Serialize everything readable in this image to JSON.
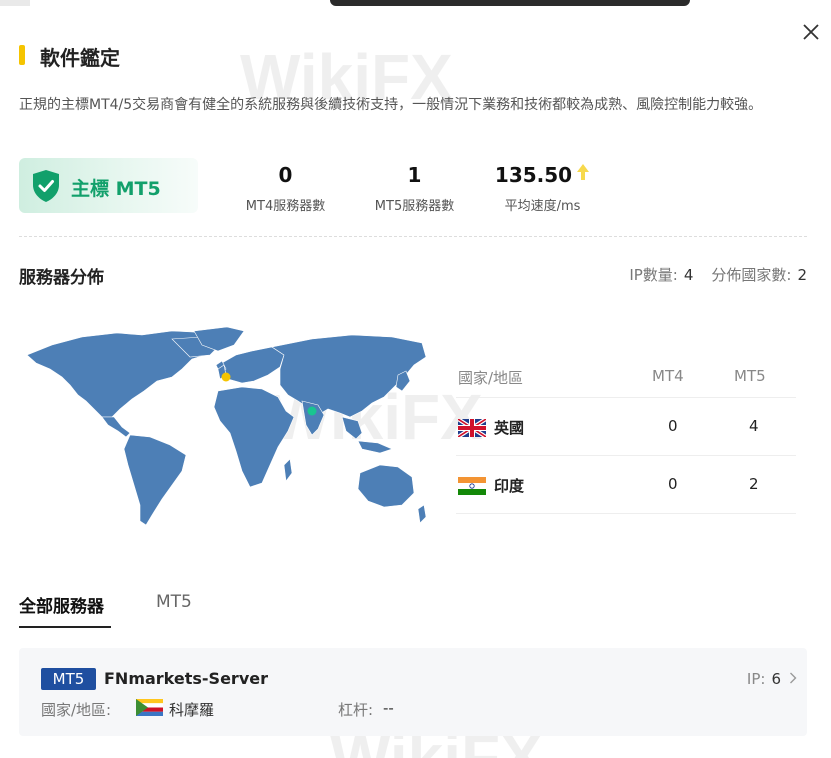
{
  "dialog": {
    "title": "軟件鑑定",
    "description": "正規的主標MT4/5交易商會有健全的系統服務與後續技術支持，一般情況下業務和技術都較為成熟、風險控制能力較強。"
  },
  "license_badge": {
    "label": "主標 MT5",
    "icon": "shield-check-icon",
    "color": "#12a06b"
  },
  "stats": {
    "mt4_servers": {
      "value": "0",
      "label": "MT4服務器數"
    },
    "mt5_servers": {
      "value": "1",
      "label": "MT5服務器數"
    },
    "avg_speed": {
      "value": "135.50",
      "label": "平均速度/ms",
      "trend_icon": "arrow-up-icon",
      "trend_color": "#f5c400"
    }
  },
  "distribution": {
    "title": "服務器分佈",
    "ip_count_label": "IP數量:",
    "ip_count": "4",
    "country_count_label": "分佈國家數:",
    "country_count": "2",
    "table": {
      "headers": [
        "國家/地區",
        "MT4",
        "MT5"
      ],
      "rows": [
        {
          "country": "英國",
          "flag": "uk-flag-icon",
          "mt4": "0",
          "mt5": "4"
        },
        {
          "country": "印度",
          "flag": "india-flag-icon",
          "mt4": "0",
          "mt5": "2"
        }
      ]
    }
  },
  "tabs": [
    {
      "label": "全部服務器",
      "active": true
    },
    {
      "label": "MT5",
      "active": false
    }
  ],
  "server": {
    "tag": "MT5",
    "name": "FNmarkets-Server",
    "ip_label": "IP:",
    "ip_count": "6",
    "region_label": "國家/地區:",
    "region_flag": "comoros-flag-icon",
    "region_name": "科摩羅",
    "leverage_label": "杠杆:",
    "leverage_value": "--"
  },
  "colors": {
    "accent_yellow": "#f5c400",
    "green": "#12a06b",
    "map_blue": "#4d7fb6",
    "tag_blue": "#1f4fa0"
  }
}
